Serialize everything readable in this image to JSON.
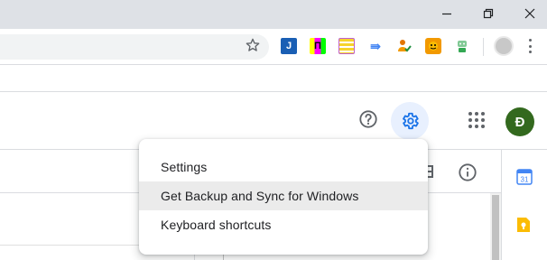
{
  "browser": {
    "window_controls": [
      "minimize-icon",
      "restore-icon",
      "close-icon"
    ],
    "toolbar": {
      "bookmark_icon": "star-icon",
      "extensions": [
        {
          "name": "joplin-extension-icon",
          "glyph": "J",
          "color": "#1a5fb4"
        },
        {
          "name": "pi-extension-icon",
          "glyph": "П",
          "color": "#000000"
        },
        {
          "name": "notes-extension-icon",
          "glyph": "",
          "color": "#f6d32d"
        },
        {
          "name": "arrow-extension-icon",
          "glyph": "⇛",
          "color": "#4285f4"
        },
        {
          "name": "person-check-extension-icon",
          "glyph": "",
          "color": "#e37400"
        },
        {
          "name": "tiger-extension-icon",
          "glyph": "",
          "color": "#f29900"
        },
        {
          "name": "robot-extension-icon",
          "glyph": "",
          "color": "#34a853"
        }
      ]
    }
  },
  "header": {
    "help_icon": "help-circle-icon",
    "settings_icon": "gear-icon",
    "apps_icon": "apps-grid-icon",
    "avatar_initial": "Đ",
    "avatar_color": "#33691e"
  },
  "toolbar_right": {
    "grid_view_icon": "grid-view-icon",
    "info_icon": "info-icon"
  },
  "side_panel": {
    "calendar_label": "31",
    "calendar_icon": "calendar-icon",
    "keep_icon": "keep-icon"
  },
  "settings_menu": {
    "items": [
      {
        "label": "Settings"
      },
      {
        "label": "Get Backup and Sync for Windows"
      },
      {
        "label": "Keyboard shortcuts"
      }
    ]
  }
}
